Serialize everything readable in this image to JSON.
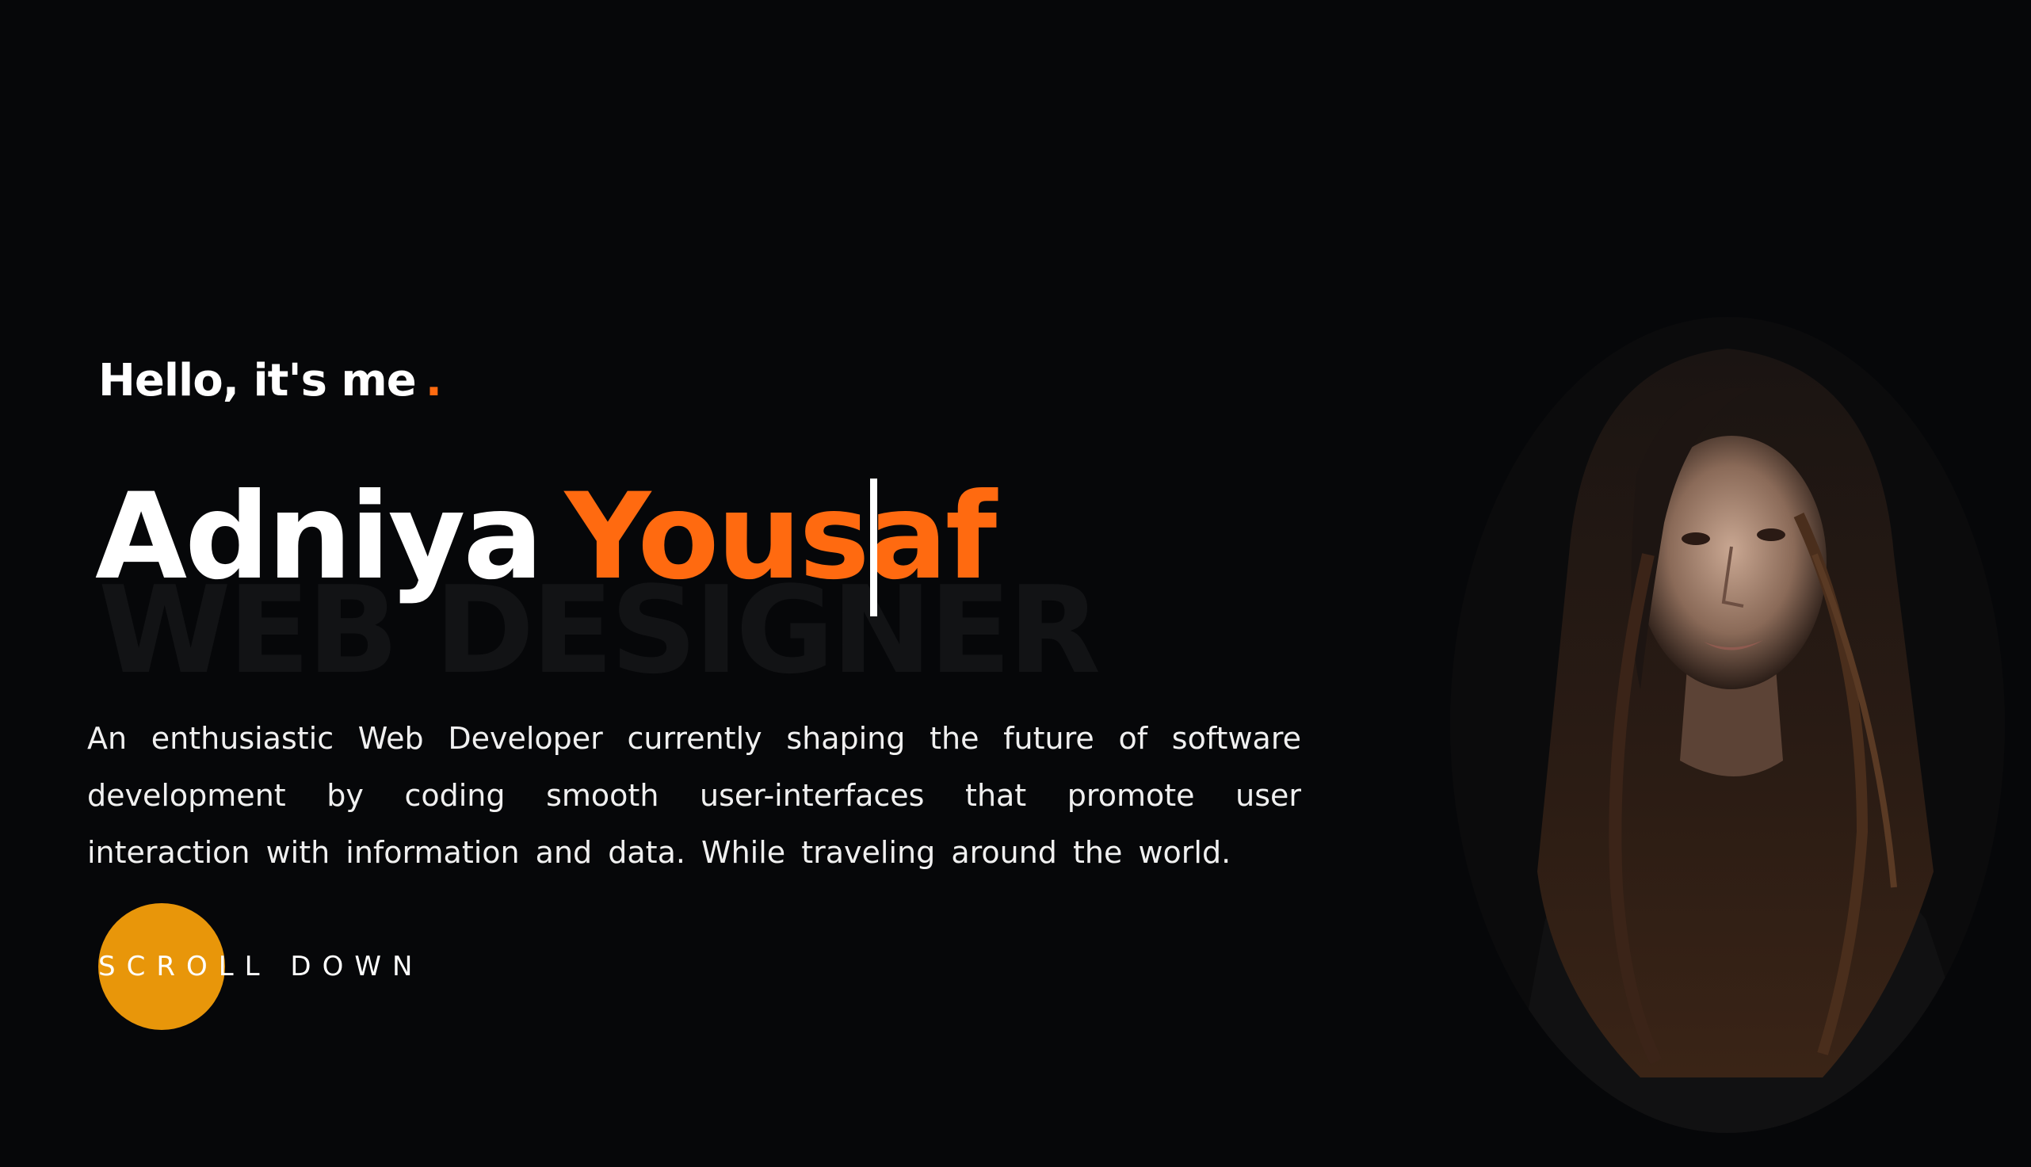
{
  "hero": {
    "greeting": "Hello, it's me",
    "greeting_dot": ".",
    "name_first": "Adniya",
    "name_last": "Yousaf",
    "watermark": "WEB DESIGNER",
    "bio": "An enthusiastic Web Developer currently shaping the future of software development by coding smooth user-interfaces that promote user interaction with information and data. While traveling around the world.",
    "scroll_label": "SCROLL DOWN"
  },
  "colors": {
    "background": "#060709",
    "accent": "#ff6a10",
    "scroll_circle": "#e8960a",
    "text": "#ffffff"
  },
  "portrait": {
    "icon": "portrait-photo"
  }
}
